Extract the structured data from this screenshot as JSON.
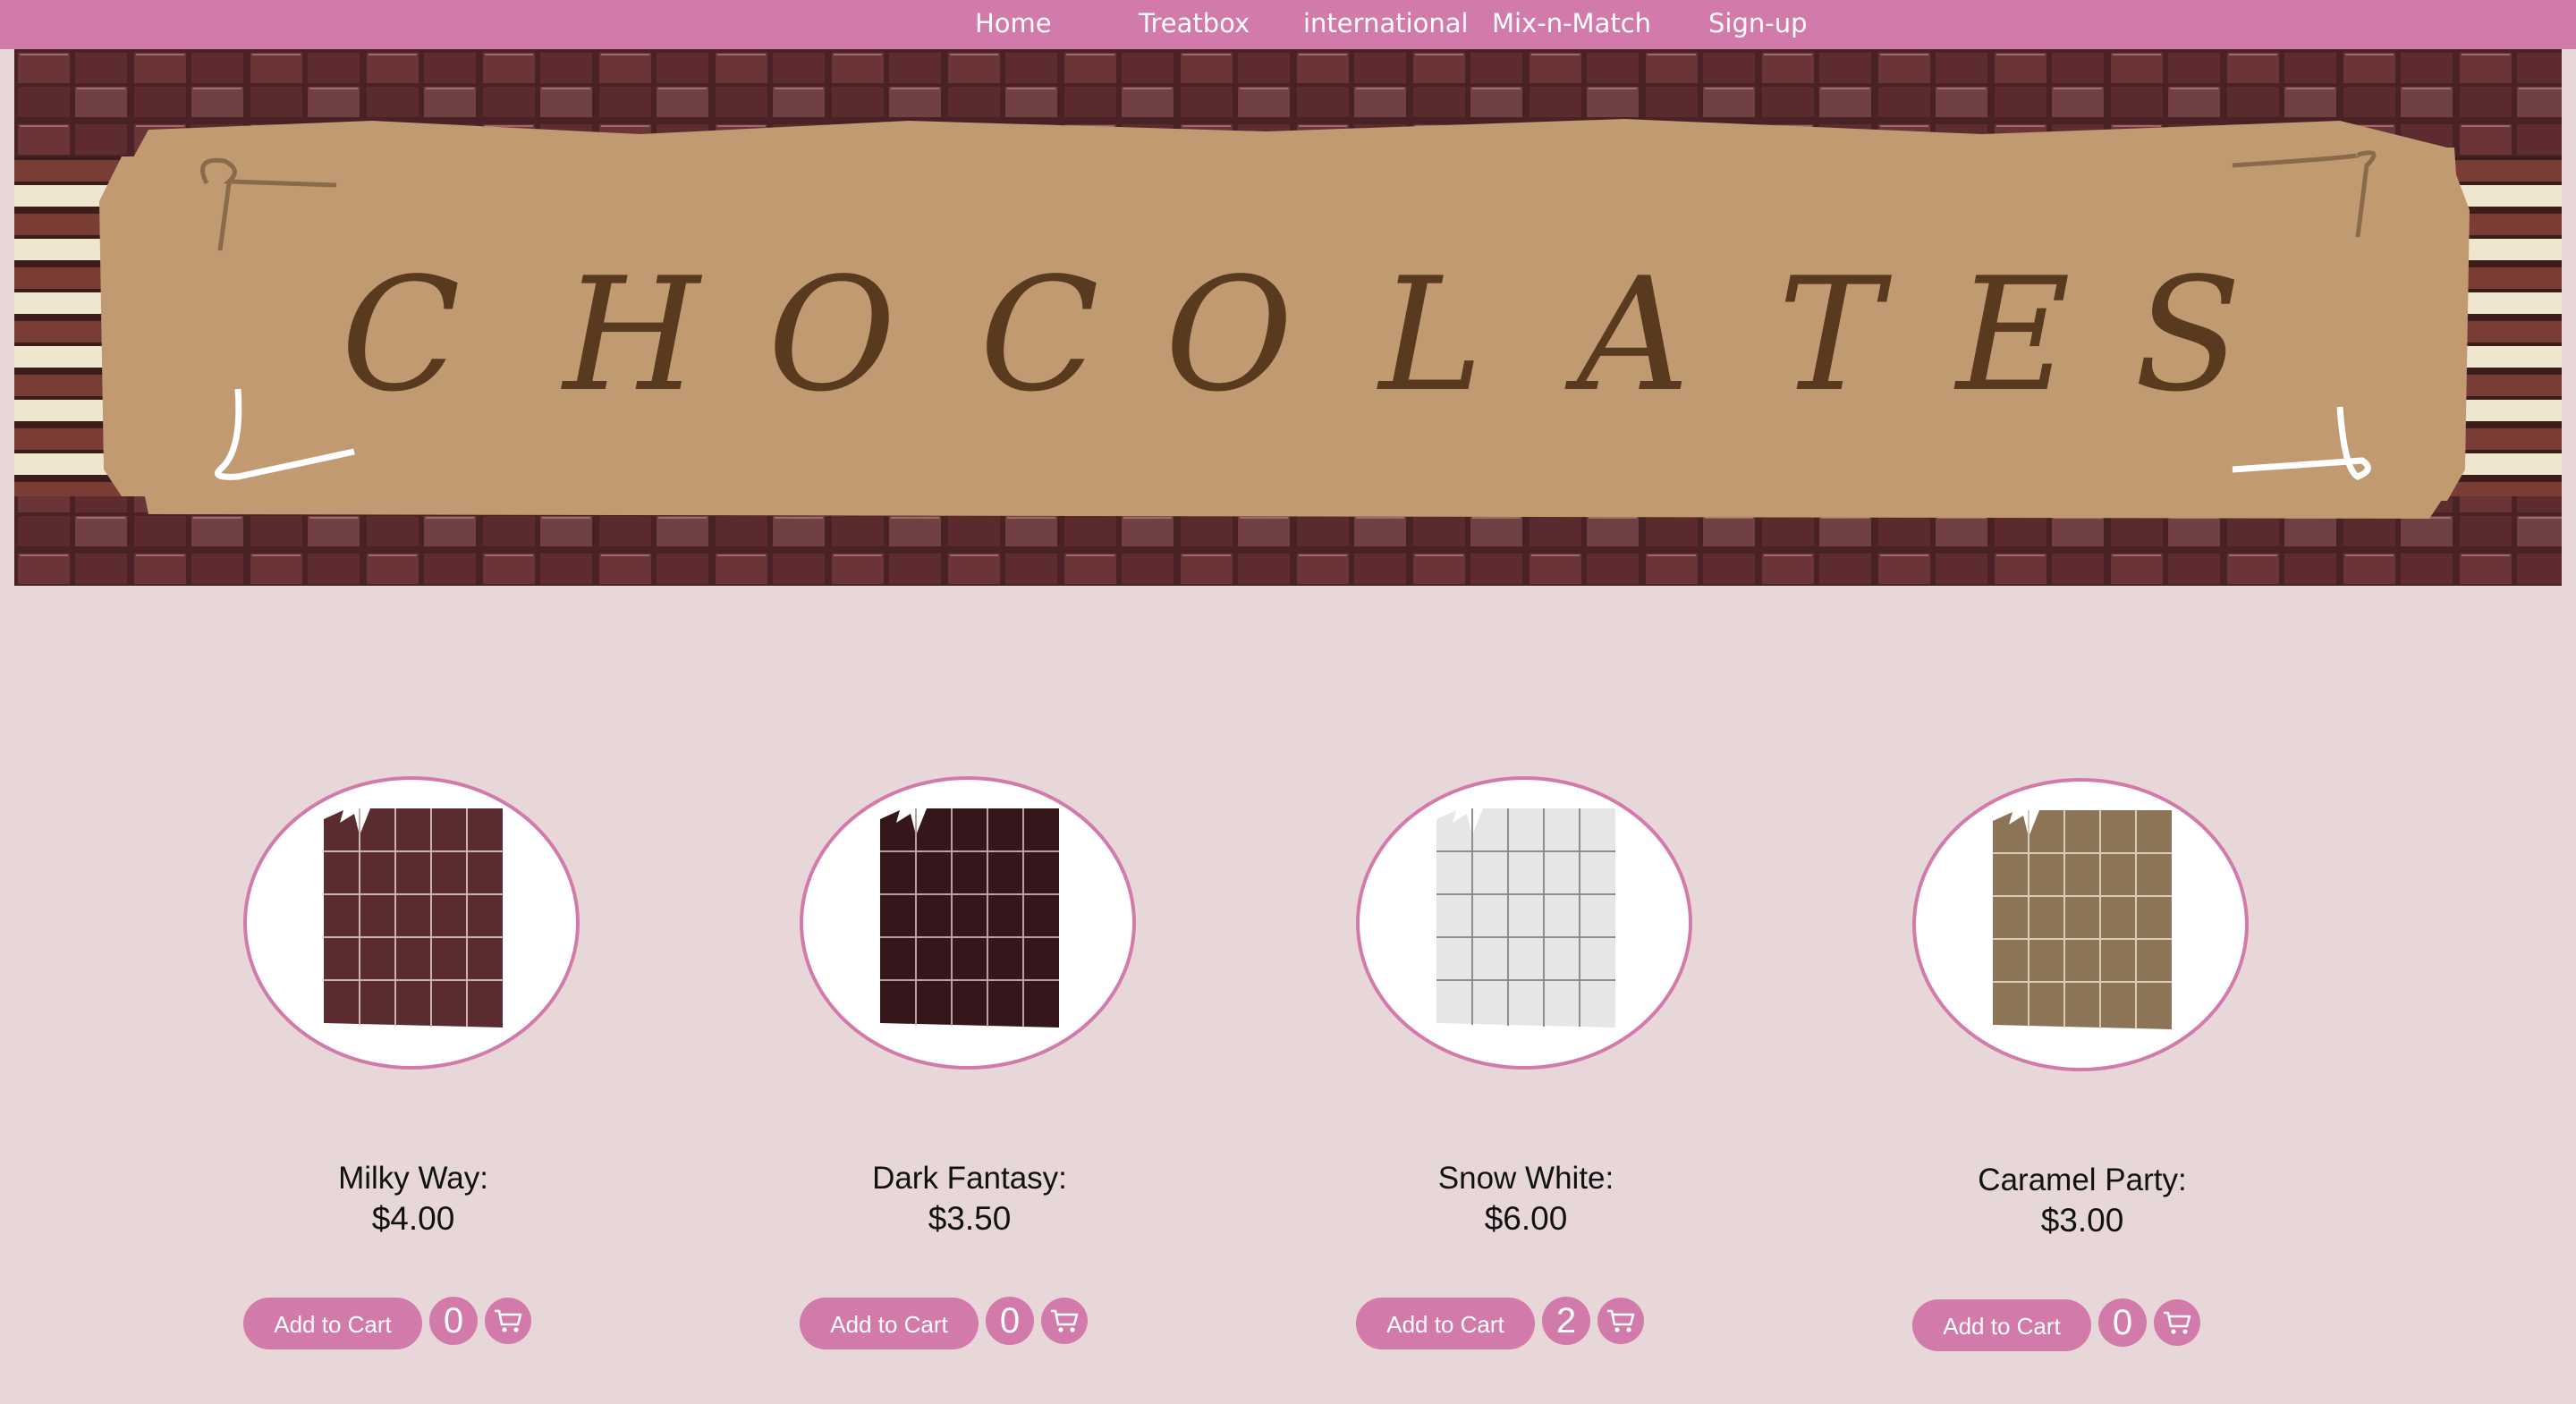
{
  "nav": {
    "items": [
      {
        "label": "Home"
      },
      {
        "label": "Treatbox"
      },
      {
        "label": "international"
      },
      {
        "label": "Mix-n-Match"
      },
      {
        "label": "Sign-up"
      }
    ]
  },
  "banner": {
    "title_letters": [
      "C",
      "H",
      "O",
      "C",
      "O",
      "L",
      "A",
      "T",
      "E",
      "S"
    ]
  },
  "colors": {
    "accent": "#d27aa9",
    "page_bg": "#e8d7d9",
    "banner_paper": "#c19a71",
    "title_brown": "#5a3a1e"
  },
  "products": [
    {
      "name": "Milky Way:",
      "price": "$4.00",
      "add_label": "Add to Cart",
      "qty": "0",
      "bar_color": "#5b2c2f",
      "cart_icon": "cart-icon"
    },
    {
      "name": "Dark Fantasy:",
      "price": "$3.50",
      "add_label": "Add to Cart",
      "qty": "0",
      "bar_color": "#35161a",
      "cart_icon": "cart-icon"
    },
    {
      "name": "Snow White:",
      "price": "$6.00",
      "add_label": "Add to Cart",
      "qty": "2",
      "bar_color": "#e6e6e6",
      "cart_icon": "cart-icon"
    },
    {
      "name": "Caramel Party:",
      "price": "$3.00",
      "add_label": "Add to Cart",
      "qty": "0",
      "bar_color": "#8b7556",
      "cart_icon": "cart-icon"
    }
  ]
}
